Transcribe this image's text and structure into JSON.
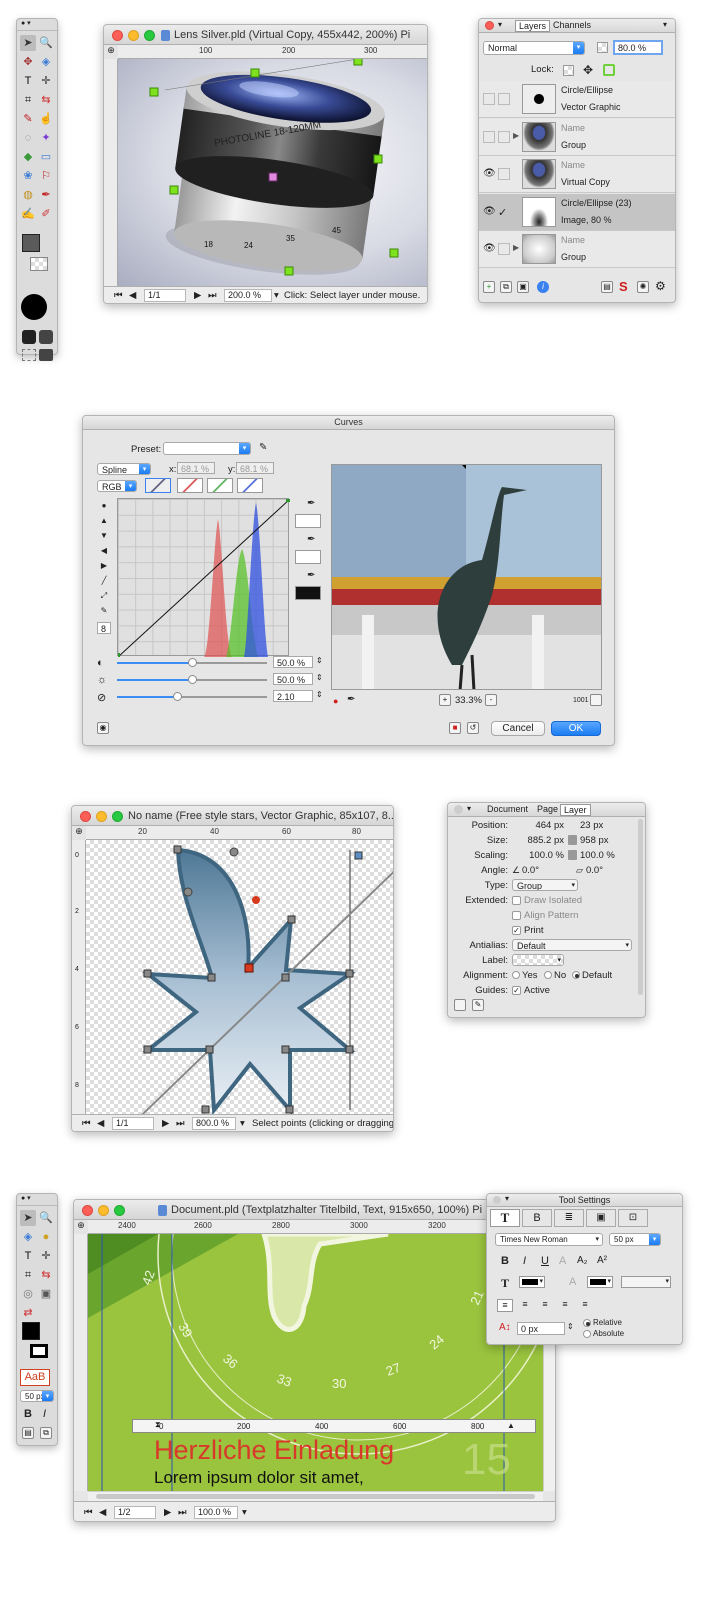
{
  "lens_window": {
    "title": "Lens Silver.pld (Virtual Copy, 455x442, 200%) Pi",
    "ruler_ticks": [
      "100",
      "200",
      "300"
    ],
    "lens_text": "PHOTOLINE 18-120MM",
    "lens_scale": [
      "18",
      "24",
      "35",
      "45"
    ],
    "page": "1/1",
    "zoom": "200.0 %",
    "status": "Click: Select layer under mouse."
  },
  "layers_panel": {
    "tabs": [
      "Layers",
      "Channels"
    ],
    "blend_mode": "Normal",
    "opacity": "80.0 %",
    "lock_label": "Lock:",
    "layers": [
      {
        "name": "Circle/Ellipse",
        "type": "Vector Graphic",
        "visible": false,
        "selected": false,
        "expand": false
      },
      {
        "name": "Name",
        "type": "Group",
        "visible": false,
        "selected": false,
        "expand": true
      },
      {
        "name": "Name",
        "type": "Virtual Copy",
        "visible": true,
        "selected": false,
        "expand": false
      },
      {
        "name": "Circle/Ellipse (23)",
        "type": "Image, 80 %",
        "visible": true,
        "selected": true,
        "expand": false
      },
      {
        "name": "Name",
        "type": "Group",
        "visible": true,
        "selected": false,
        "expand": true
      }
    ]
  },
  "curves": {
    "title": "Curves",
    "preset_label": "Preset:",
    "mode": "Spline",
    "x_label": "x:",
    "x_value": "68.1 %",
    "y_label": "y:",
    "y_value": "68.1 %",
    "channel": "RGB",
    "point_count": "8",
    "sliders": [
      {
        "icon": "contrast-icon",
        "value": "50.0 %",
        "level": 0.5
      },
      {
        "icon": "brightness-icon",
        "value": "50.0 %",
        "level": 0.5
      },
      {
        "icon": "gamma-icon",
        "value": "2.10",
        "level": 0.4
      }
    ],
    "preview_zoom": "33.3%",
    "preview_info": "1001",
    "cancel_label": "Cancel",
    "ok_label": "OK"
  },
  "star_window": {
    "title": "No name (Free style stars, Vector Graphic, 85x107, 8...",
    "ruler_ticks": [
      "20",
      "40",
      "60",
      "80"
    ],
    "vruler_ticks": [
      "0",
      "2",
      "4",
      "6",
      "8"
    ],
    "page": "1/1",
    "zoom": "800.0 %",
    "status": "Select points (clicking or dragging,"
  },
  "layer_props": {
    "tabs": [
      "Document",
      "Page",
      "Layer"
    ],
    "position_label": "Position:",
    "position_x": "464 px",
    "position_y": "23 px",
    "size_label": "Size:",
    "size_w": "885.2 px",
    "size_h": "958 px",
    "scaling_label": "Scaling:",
    "scaling_x": "100.0 %",
    "scaling_y": "100.0 %",
    "angle_label": "Angle:",
    "angle": "0.0°",
    "shear": "0.0°",
    "type_label": "Type:",
    "type": "Group",
    "extended_label": "Extended:",
    "draw_isolated": "Draw Isolated",
    "align_pattern": "Align Pattern",
    "print": "Print",
    "antialias_label": "Antialias:",
    "antialias": "Default",
    "label_label": "Label:",
    "alignment_label": "Alignment:",
    "align_yes": "Yes",
    "align_no": "No",
    "align_default": "Default",
    "guides_label": "Guides:",
    "guides_active": "Active"
  },
  "doc_window": {
    "title": "Document.pld (Textplatzhalter Titelbild, Text, 915x650, 100%) Pi",
    "ruler_ticks": [
      "2400",
      "2600",
      "2800",
      "3000",
      "3200"
    ],
    "dial_numbers": [
      "42",
      "39",
      "36",
      "33",
      "30",
      "27",
      "24",
      "21"
    ],
    "text_ruler_ticks": [
      "0",
      "200",
      "400",
      "600",
      "800"
    ],
    "heading": "Herzliche Einladung",
    "body": "Lorem ipsum dolor sit amet,",
    "big_number": "15",
    "page": "1/2",
    "zoom": "100.0 %"
  },
  "tool_settings": {
    "title": "Tool Settings",
    "font": "Times New Roman",
    "size": "50 px",
    "bold": "B",
    "italic": "I",
    "underline": "U",
    "subscript": "A₂",
    "superscript": "A²",
    "offset": "0 px",
    "relative": "Relative",
    "absolute": "Absolute"
  },
  "toolbox2": {
    "text_preview": "AaB",
    "size": "50 px",
    "bold": "B",
    "italic": "I"
  },
  "colors": {
    "accent": "#1b7cf2",
    "heading_red": "#d8392a",
    "green_bg": "#9ac43e",
    "handle_green": "#7ee31e"
  }
}
